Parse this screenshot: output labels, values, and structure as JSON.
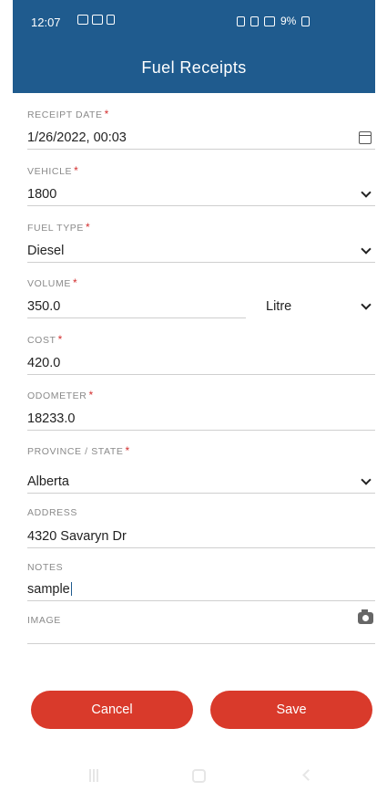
{
  "status_bar": {
    "time": "12:07",
    "battery": "9%"
  },
  "header": {
    "title": "Fuel Receipts"
  },
  "form": {
    "receipt_date": {
      "label": "RECEIPT DATE",
      "required": "*",
      "value": "1/26/2022, 00:03",
      "icon": "calendar-icon"
    },
    "vehicle": {
      "label": "VEHICLE",
      "required": "*",
      "value": "1800"
    },
    "fuel_type": {
      "label": "FUEL TYPE",
      "required": "*",
      "value": "Diesel"
    },
    "volume": {
      "label": "VOLUME",
      "required": "*",
      "value": "350.0",
      "unit": "Litre"
    },
    "cost": {
      "label": "COST",
      "required": "*",
      "value": "420.0"
    },
    "odometer": {
      "label": "ODOMETER",
      "required": "*",
      "value": "18233.0"
    },
    "province": {
      "label": "PROVINCE / STATE",
      "required": "*",
      "value": "Alberta"
    },
    "address": {
      "label": "ADDRESS",
      "value": "4320 Savaryn Dr"
    },
    "notes": {
      "label": "NOTES",
      "value": "sample"
    },
    "image": {
      "label": "IMAGE",
      "icon": "camera-icon"
    }
  },
  "actions": {
    "cancel_label": "Cancel",
    "save_label": "Save"
  },
  "colors": {
    "header_bg": "#1f5b8e",
    "button_bg": "#d93a2b",
    "required": "#d32f2f"
  }
}
